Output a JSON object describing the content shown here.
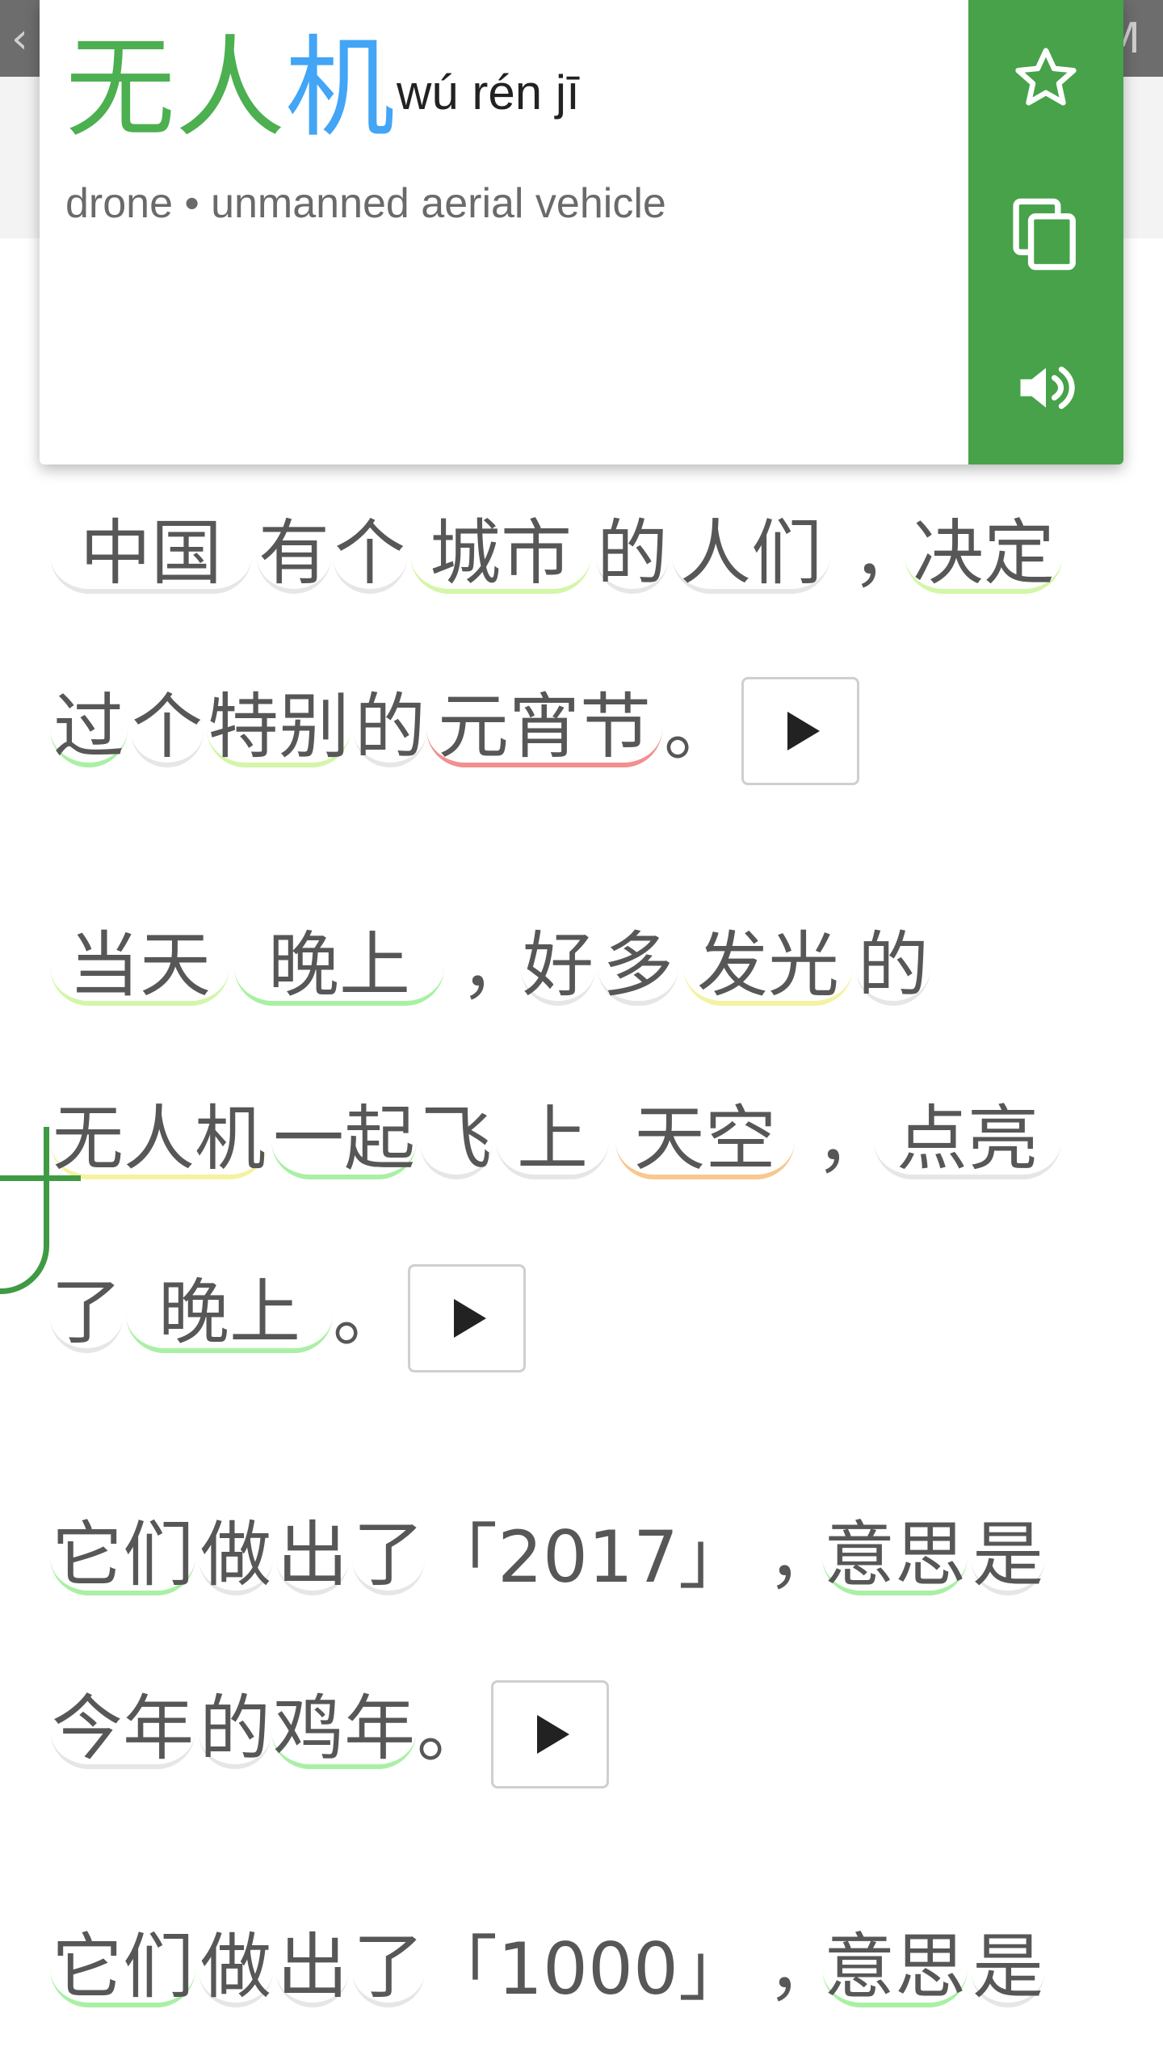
{
  "popup": {
    "headword": [
      "无",
      "人",
      "机"
    ],
    "headword_colors": [
      "#4caf50",
      "#4caf50",
      "#42a5f5"
    ],
    "pinyin": "wú rén jī",
    "definition": "drone • unmanned aerial vehicle",
    "actions": [
      {
        "name": "star-icon",
        "label": "favorite"
      },
      {
        "name": "copy-icon",
        "label": "copy"
      },
      {
        "name": "speaker-icon",
        "label": "speak"
      }
    ],
    "accent_color": "#47a24a"
  },
  "paragraphs": [
    {
      "lines": [
        {
          "tokens": [
            "中国",
            "有",
            "个",
            "城市",
            "的",
            "人们",
            "，",
            "决定"
          ]
        },
        {
          "tokens": [
            "过",
            "个",
            "特别",
            "的",
            "元宵节",
            "。"
          ]
        }
      ]
    },
    {
      "lines": [
        {
          "tokens": [
            "当天",
            "晚上",
            "，",
            "好",
            "多",
            "发光",
            "的"
          ]
        },
        {
          "tokens": [
            "无人机",
            "一起",
            "飞",
            "上",
            "天空",
            "，",
            "点亮"
          ]
        },
        {
          "tokens": [
            "了",
            "晚上",
            "。"
          ]
        }
      ]
    },
    {
      "lines": [
        {
          "tokens": [
            "它们",
            "做",
            "出",
            "了",
            "「2017」",
            "，",
            "意思",
            "是"
          ]
        },
        {
          "tokens": [
            "今年",
            "的",
            "鸡年",
            "。"
          ]
        }
      ]
    },
    {
      "lines": [
        {
          "tokens": [
            "它们",
            "做",
            "出",
            "了",
            "「1000」",
            "，",
            "意思",
            "是"
          ]
        }
      ]
    }
  ]
}
